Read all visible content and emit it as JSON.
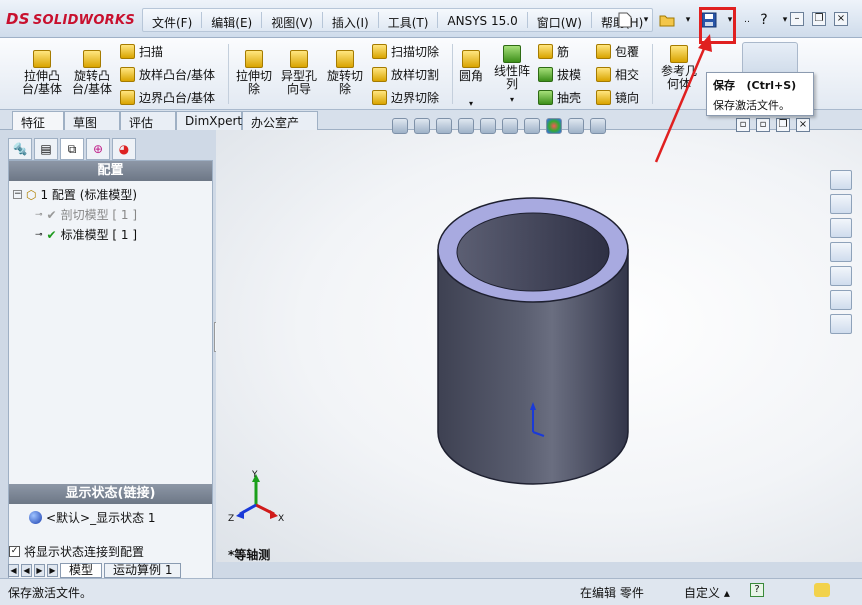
{
  "app": {
    "logo_text": "SOLIDWORKS",
    "logo_mark": "DS"
  },
  "menu": [
    "文件(F)",
    "编辑(E)",
    "视图(V)",
    "插入(I)",
    "工具(T)",
    "ANSYS 15.0",
    "窗口(W)",
    "帮助(H)"
  ],
  "ribbon": {
    "large": [
      {
        "label": "拉伸凸\n台/基体"
      },
      {
        "label": "旋转凸\n台/基体"
      },
      {
        "label": "拉伸切\n除"
      },
      {
        "label": "异型孔\n向导"
      },
      {
        "label": "旋转切\n除"
      },
      {
        "label": "圆角"
      },
      {
        "label": "线性阵\n列"
      },
      {
        "label": "参考几\n何体"
      }
    ],
    "small": [
      "扫描",
      "放样凸台/基体",
      "边界凸台/基体",
      "扫描切除",
      "放样切割",
      "边界切除",
      "筋",
      "拔模",
      "抽壳",
      "包覆",
      "相交",
      "镜向"
    ]
  },
  "tooltip": {
    "title": "保存   (Ctrl+S)",
    "desc": "保存激活文件。"
  },
  "tabs": [
    "特征",
    "草图",
    "评估",
    "DimXpert",
    "办公室产品"
  ],
  "panel": {
    "config_header": "配置",
    "root": "1 配置 (标准模型)",
    "item1": "剖切模型 [ 1 ]",
    "item2": "标准模型 [ 1 ]",
    "display_header": "显示状态(链接)",
    "display_item": "<默认>_显示状态 1",
    "checkbox_label": "将显示状态连接到配置"
  },
  "viewport": {
    "view_name": "*等轴测",
    "axis": {
      "x": "X",
      "y": "Y",
      "z": "Z"
    }
  },
  "bottom_tabs": [
    "模型",
    "运动算例 1"
  ],
  "status": {
    "left": "保存激活文件。",
    "mid": "在编辑 零件",
    "custom": "自定义",
    "help": "?"
  },
  "colors": {
    "highlight": "#e02020",
    "part": "#545869"
  }
}
